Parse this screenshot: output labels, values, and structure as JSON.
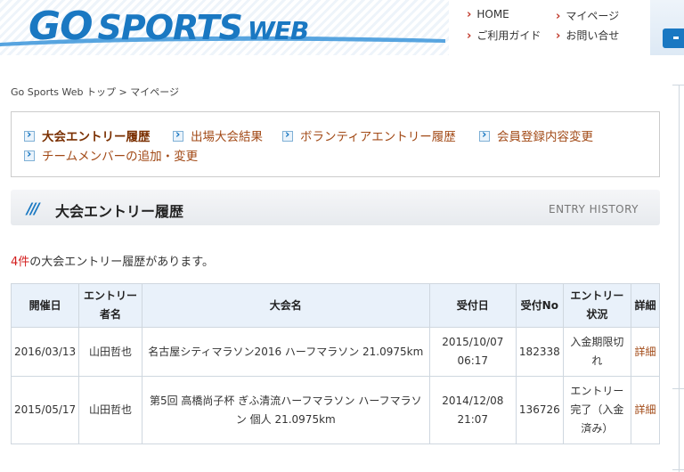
{
  "header": {
    "logo": "GO SPORTS WEB",
    "nav": {
      "home": "HOME",
      "mypage": "マイページ",
      "guide": "ご利用ガイド",
      "contact": "お問い合せ"
    }
  },
  "breadcrumb": "Go Sports Web トップ > マイページ",
  "tabs": [
    "大会エントリー履歴",
    "出場大会結果",
    "ボランティアエントリー履歴",
    "会員登録内容変更",
    "チームメンバーの追加・変更"
  ],
  "section": {
    "title": "大会エントリー履歴",
    "en": "ENTRY HISTORY"
  },
  "count": {
    "number": "4件",
    "text": "の大会エントリー履歴があります。"
  },
  "table": {
    "headers": [
      "開催日",
      "エントリー者名",
      "大会名",
      "受付日",
      "受付No",
      "エントリー状況",
      "詳細"
    ],
    "rows": [
      {
        "date": "2016/03/13",
        "name": "山田哲也",
        "event": "名古屋シティマラソン2016 ハーフマラソン 21.0975km",
        "received": "2015/10/07 06:17",
        "no": "182338",
        "status": "入金期限切れ",
        "detail": "詳細"
      },
      {
        "date": "2015/05/17",
        "name": "山田哲也",
        "event": "第5回 高橋尚子杯 ぎふ清流ハーフマラソン ハーフマラソン 個人 21.0975km",
        "received": "2014/12/08 21:07",
        "no": "136726",
        "status": "エントリー完了（入金済み）",
        "detail": "詳細"
      }
    ]
  }
}
